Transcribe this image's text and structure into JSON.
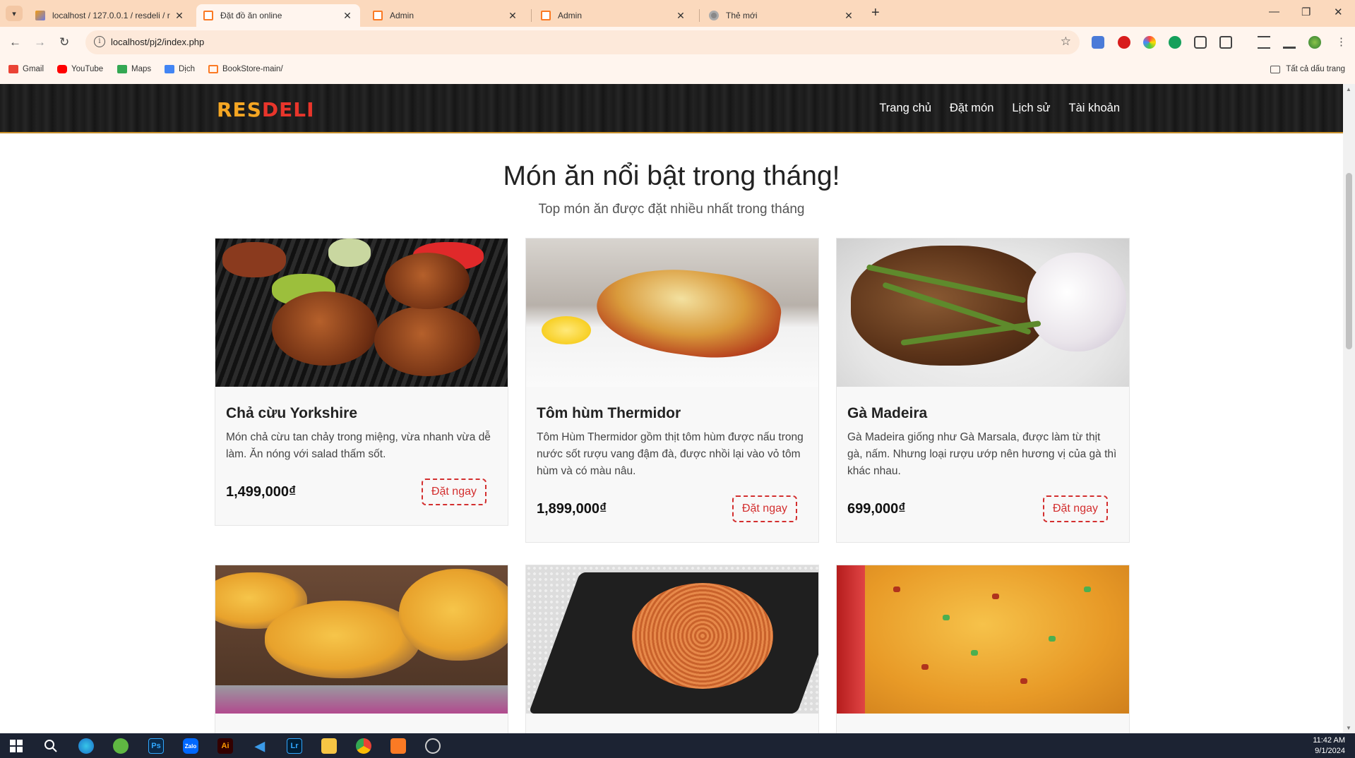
{
  "browser": {
    "tabs": [
      {
        "title": "localhost / 127.0.0.1 / resdeli / r",
        "favicon": "phpmyadmin-icon",
        "active": false
      },
      {
        "title": "Đặt đồ ăn online",
        "favicon": "xampp-icon",
        "active": true
      },
      {
        "title": "Admin",
        "favicon": "xampp-icon",
        "active": false
      },
      {
        "title": "Admin",
        "favicon": "xampp-icon",
        "active": false
      },
      {
        "title": "Thẻ mới",
        "favicon": "chrome-icon",
        "active": false
      }
    ],
    "url": "localhost/pj2/index.php",
    "bookmarks": [
      {
        "label": "Gmail",
        "color": "#ea4335"
      },
      {
        "label": "YouTube",
        "color": "#ff0000"
      },
      {
        "label": "Maps",
        "color": "#34a853"
      },
      {
        "label": "Dịch",
        "color": "#4285f4"
      },
      {
        "label": "BookStore-main/",
        "color": "#fb7a24"
      }
    ],
    "all_bookmarks": "Tất cả dấu trang"
  },
  "site": {
    "logo_part1": "RES",
    "logo_part2": "DELI",
    "nav": [
      "Trang chủ",
      "Đặt món",
      "Lịch sử",
      "Tài khoản"
    ],
    "section_title": "Món ăn nổi bật trong tháng!",
    "section_subtitle": "Top món ăn được đặt nhiều nhất trong tháng",
    "order_label": "Đặt ngay",
    "dishes": [
      {
        "name": "Chả cừu Yorkshire",
        "desc": "Món chả cừu tan chảy trong miệng, vừa nhanh vừa dễ làm. Ăn nóng với salad thấm sốt.",
        "price": "1,499,000₫"
      },
      {
        "name": "Tôm hùm Thermidor",
        "desc": "Tôm Hùm Thermidor gồm thịt tôm hùm được nấu trong nước sốt rượu vang đậm đà, được nhồi lại vào vỏ tôm hùm và có màu nâu.",
        "price": "1,899,000₫"
      },
      {
        "name": "Gà Madeira",
        "desc": "Gà Madeira giống như Gà Marsala, được làm từ thịt gà, nấm. Nhưng loại rượu ướp nên hương vị của gà thì khác nhau.",
        "price": "699,000₫"
      }
    ]
  },
  "taskbar": {
    "time": "11:42 AM",
    "date": "9/1/2024"
  }
}
